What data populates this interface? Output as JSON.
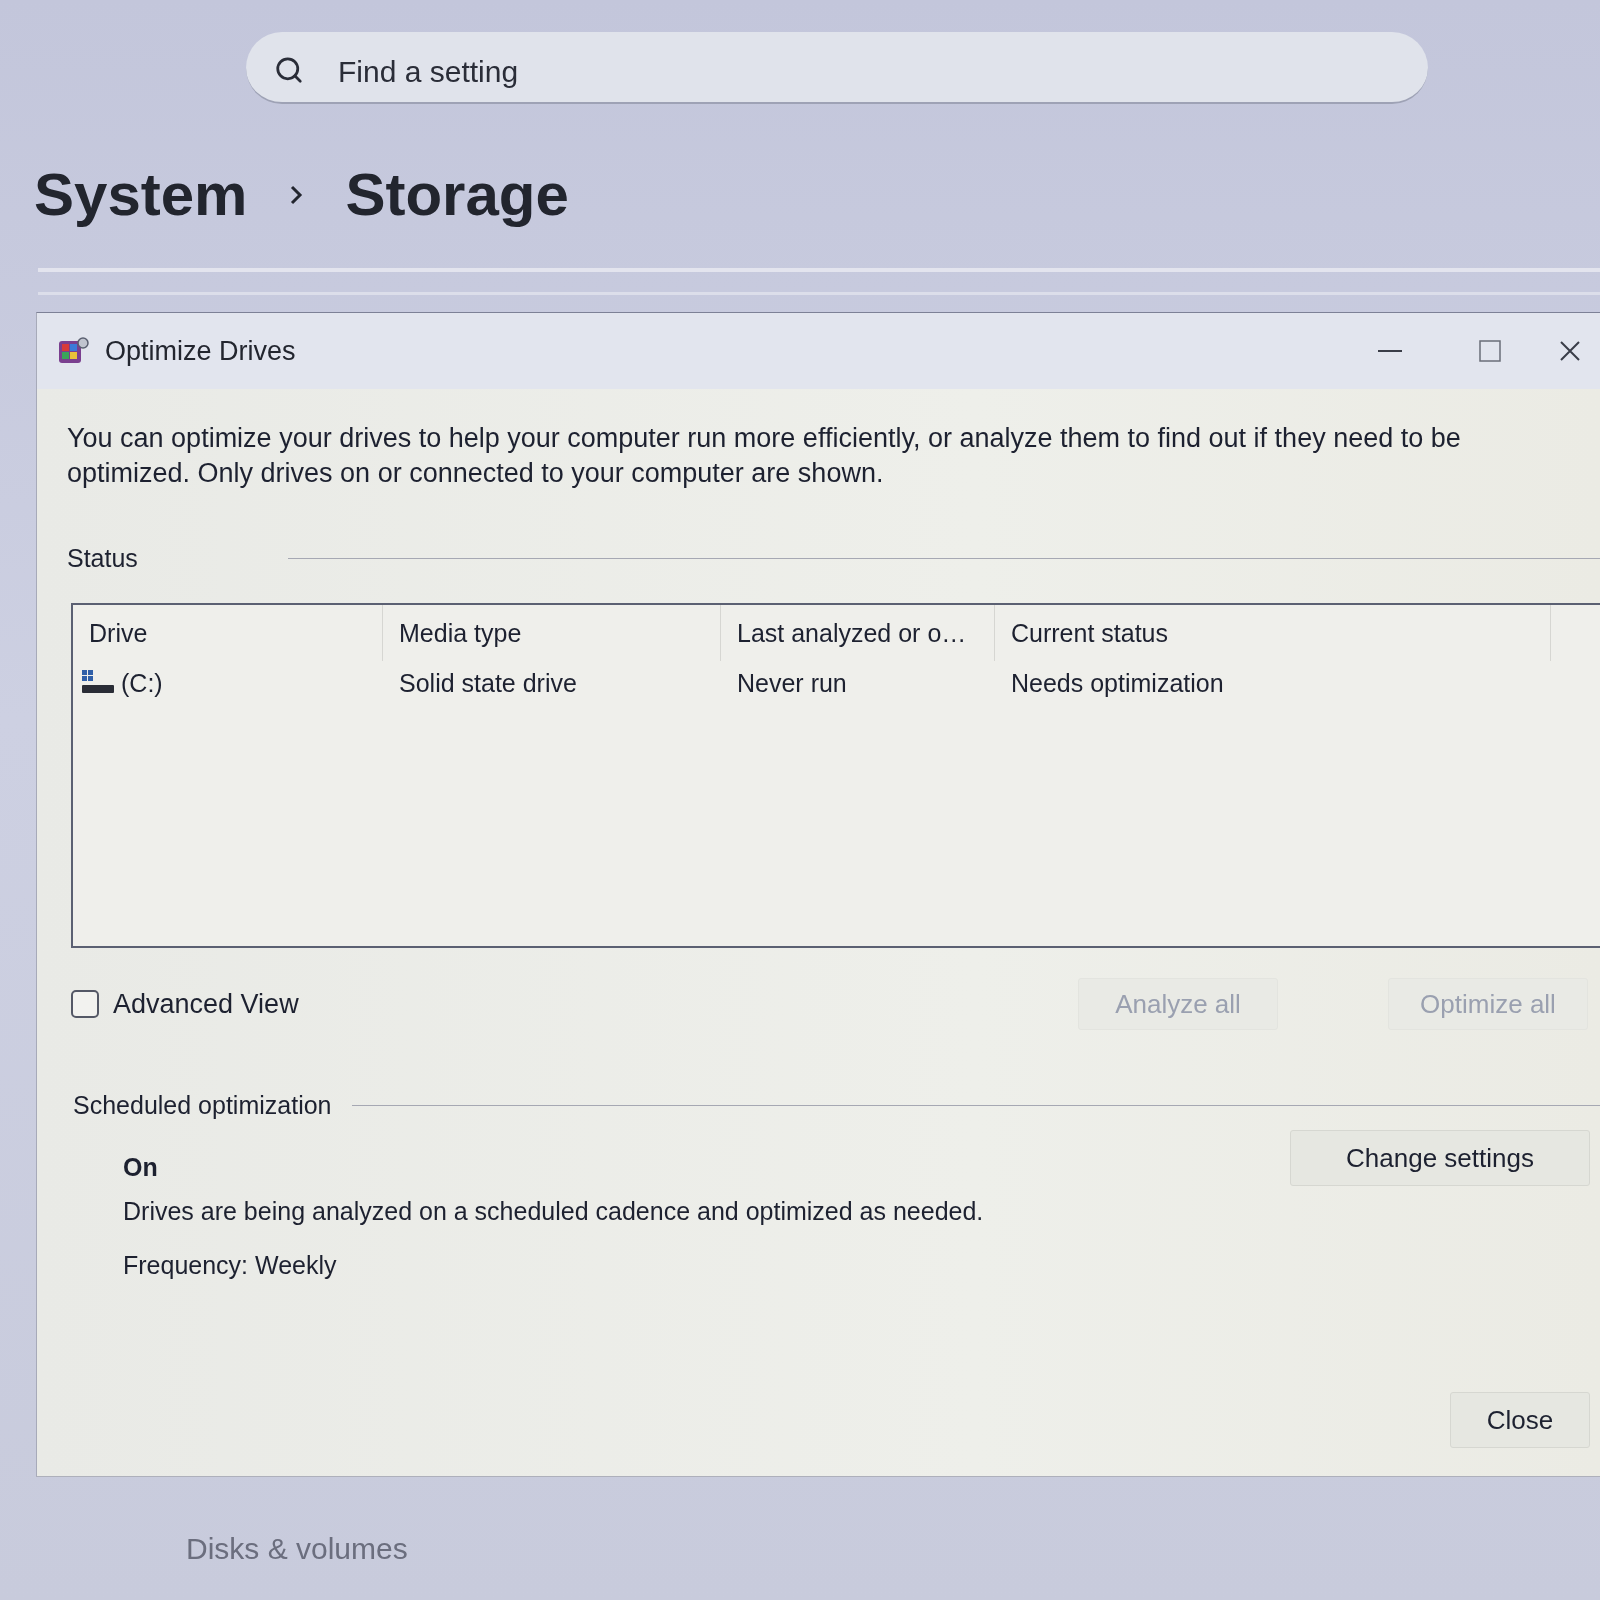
{
  "search": {
    "placeholder": "Find a setting"
  },
  "breadcrumb": [
    {
      "label": "System"
    },
    {
      "label": "Storage"
    }
  ],
  "dialog": {
    "title": "Optimize Drives",
    "description": "You can optimize your drives to help your computer run more efficiently, or analyze them to find out if they need to be optimized. Only drives on or connected to your computer are shown.",
    "status_label": "Status",
    "table": {
      "columns": [
        "Drive",
        "Media type",
        "Last analyzed or o…",
        "Current status"
      ],
      "rows": [
        {
          "cells": [
            "(C:)",
            "Solid state drive",
            "Never run",
            "Needs optimization"
          ]
        }
      ]
    },
    "advanced_view": {
      "label": "Advanced View",
      "checked": false
    },
    "actions": [
      {
        "label": "Analyze all",
        "disabled": true
      },
      {
        "label": "Optimize all",
        "disabled": true
      }
    ],
    "schedule": {
      "heading": "Scheduled optimization",
      "state": "On",
      "description": "Drives are being analyzed on a scheduled cadence and optimized as needed.",
      "frequency": "Frequency: Weekly",
      "button": "Change settings"
    },
    "close_button": "Close"
  },
  "nav_item": {
    "label": "Disks & volumes"
  }
}
